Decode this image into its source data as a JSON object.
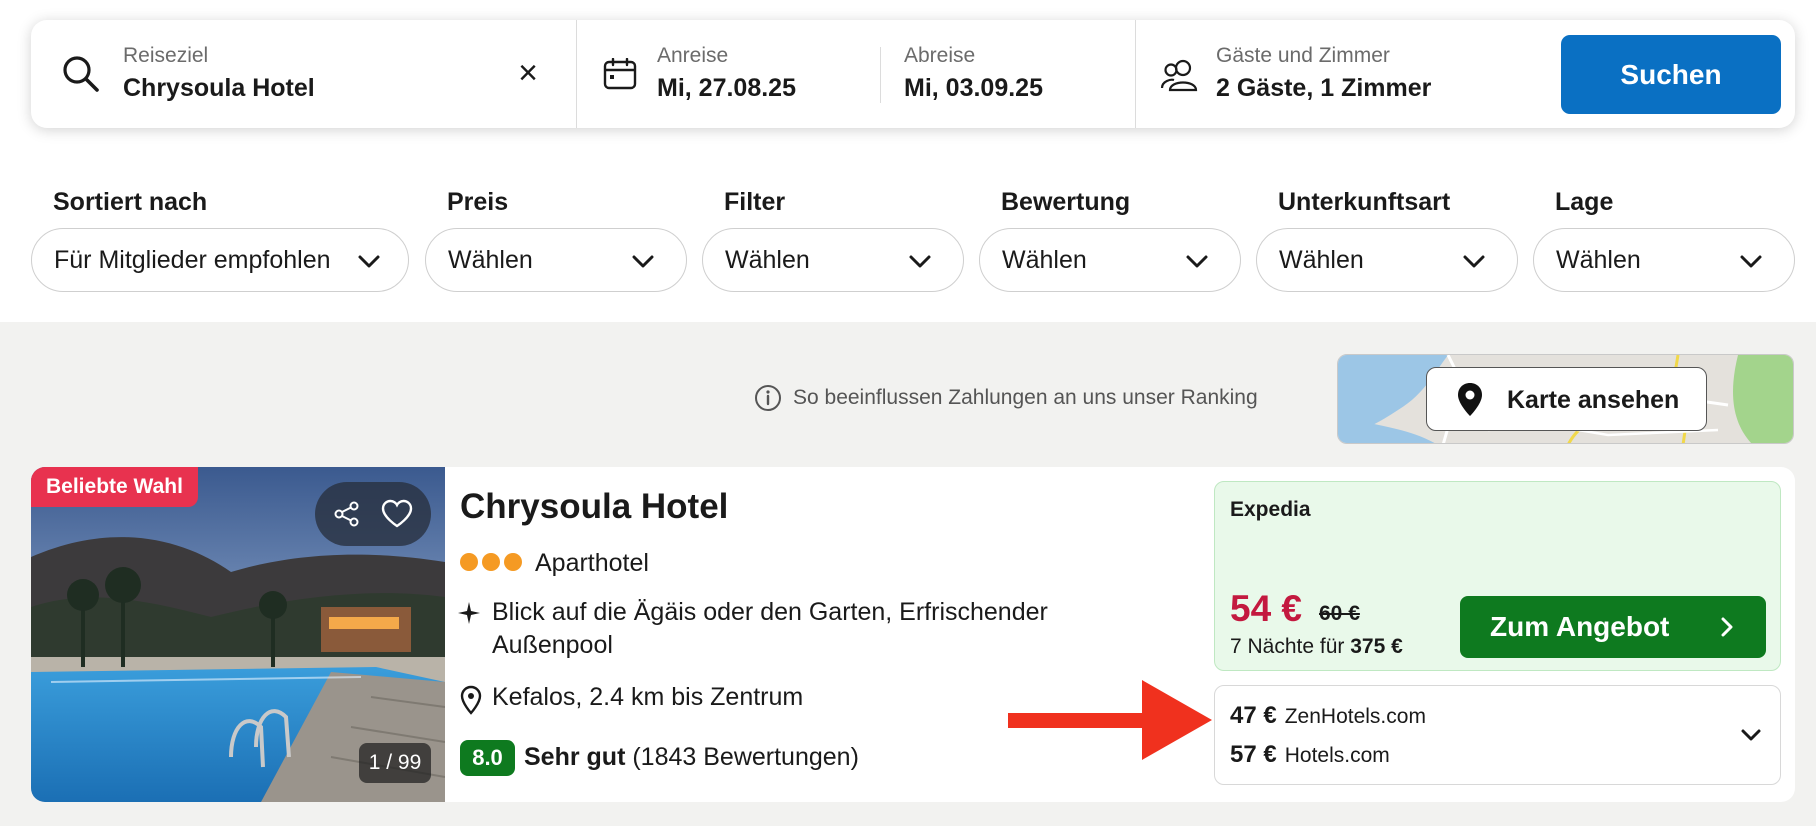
{
  "search": {
    "destination_label": "Reiseziel",
    "destination_value": "Chrysoula Hotel",
    "clear_icon": "close-icon",
    "checkin_label": "Anreise",
    "checkin_value": "Mi, 27.08.25",
    "checkout_label": "Abreise",
    "checkout_value": "Mi, 03.09.25",
    "guests_label": "Gäste und Zimmer",
    "guests_value": "2 Gäste, 1 Zimmer",
    "search_button": "Suchen",
    "accent": "#0a70c3"
  },
  "filters": [
    {
      "title": "Sortiert nach",
      "value": "Für Mitglieder empfohlen"
    },
    {
      "title": "Preis",
      "value": "Wählen"
    },
    {
      "title": "Filter",
      "value": "Wählen"
    },
    {
      "title": "Bewertung",
      "value": "Wählen"
    },
    {
      "title": "Unterkunftsart",
      "value": "Wählen"
    },
    {
      "title": "Lage",
      "value": "Wählen"
    }
  ],
  "ranking_info": "So beeinflussen Zahlungen an uns unser Ranking",
  "map": {
    "button_label": "Karte ansehen"
  },
  "hotel": {
    "badge": "Beliebte Wahl",
    "photo_counter": "1 / 99",
    "name": "Chrysoula Hotel",
    "stars": 3,
    "type": "Aparthotel",
    "features": "Blick auf die Ägäis oder den Garten, Erfrischender Außenpool",
    "location": "Kefalos, 2.4 km bis Zentrum",
    "score": "8.0",
    "score_label": "Sehr gut",
    "reviews": "(1843 Bewertungen)"
  },
  "offer": {
    "provider": "Expedia",
    "price": "54 €",
    "old_price": "60 €",
    "nights_prefix": "7 Nächte für",
    "total": "375 €",
    "button": "Zum Angebot",
    "price_color": "#c3193f",
    "button_color": "#0e7a1f"
  },
  "alternatives": [
    {
      "price": "47 €",
      "provider": "ZenHotels.com"
    },
    {
      "price": "57 €",
      "provider": "Hotels.com"
    }
  ],
  "annotation": {
    "arrow_color": "#f0311e"
  }
}
